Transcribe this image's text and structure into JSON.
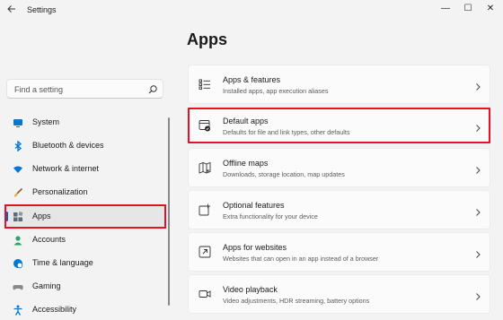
{
  "window": {
    "title": "Settings",
    "controls": {
      "minimize": "—",
      "maximize": "☐",
      "close": "✕"
    }
  },
  "search": {
    "placeholder": "Find a setting"
  },
  "sidebar": {
    "selected": "Apps",
    "items": [
      {
        "label": "System",
        "icon": "system-icon",
        "color": "#0078d4"
      },
      {
        "label": "Bluetooth & devices",
        "icon": "bluetooth-icon",
        "color": "#0078d4"
      },
      {
        "label": "Network & internet",
        "icon": "wifi-icon",
        "color": "#0078d4"
      },
      {
        "label": "Personalization",
        "icon": "paintbrush-icon",
        "color": "#e8a33d"
      },
      {
        "label": "Apps",
        "icon": "apps-icon",
        "color": "#5b6b80"
      },
      {
        "label": "Accounts",
        "icon": "person-icon",
        "color": "#2fa36b"
      },
      {
        "label": "Time & language",
        "icon": "globe-clock-icon",
        "color": "#0078d4"
      },
      {
        "label": "Gaming",
        "icon": "controller-icon",
        "color": "#8a8a8a"
      },
      {
        "label": "Accessibility",
        "icon": "accessibility-icon",
        "color": "#0078d4"
      }
    ]
  },
  "main": {
    "title": "Apps",
    "cards": [
      {
        "title": "Apps & features",
        "subtitle": "Installed apps, app execution aliases",
        "icon": "list-icon"
      },
      {
        "title": "Default apps",
        "subtitle": "Defaults for file and link types, other defaults",
        "icon": "default-apps-icon"
      },
      {
        "title": "Offline maps",
        "subtitle": "Downloads, storage location, map updates",
        "icon": "map-icon"
      },
      {
        "title": "Optional features",
        "subtitle": "Extra functionality for your device",
        "icon": "add-box-icon"
      },
      {
        "title": "Apps for websites",
        "subtitle": "Websites that can open in an app instead of a browser",
        "icon": "open-link-icon"
      },
      {
        "title": "Video playback",
        "subtitle": "Video adjustments, HDR streaming, battery options",
        "icon": "video-icon"
      }
    ]
  },
  "accent": "#0067c0",
  "highlight": "#e81123"
}
